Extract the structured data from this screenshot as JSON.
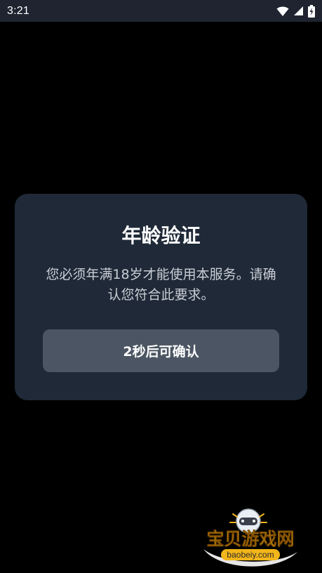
{
  "status_bar": {
    "time": "3:21",
    "icons": [
      "wifi-icon",
      "cellular-signal-icon",
      "battery-charging-icon"
    ]
  },
  "dialog": {
    "title": "年龄验证",
    "message": "您必须年满18岁才能使用本服务。请确认您符合此要求。",
    "confirm_button_label": "2秒后可确认"
  },
  "watermark": {
    "brand": "宝贝游戏网",
    "url": "baobeiy.com"
  },
  "colors": {
    "background": "#000000",
    "status_bar": "#1f2430",
    "dialog_bg": "#1f2937",
    "button_bg": "#4b5563",
    "text_primary": "#ffffff",
    "text_secondary": "#c9ced6",
    "watermark_gold": "#f2b51a"
  }
}
